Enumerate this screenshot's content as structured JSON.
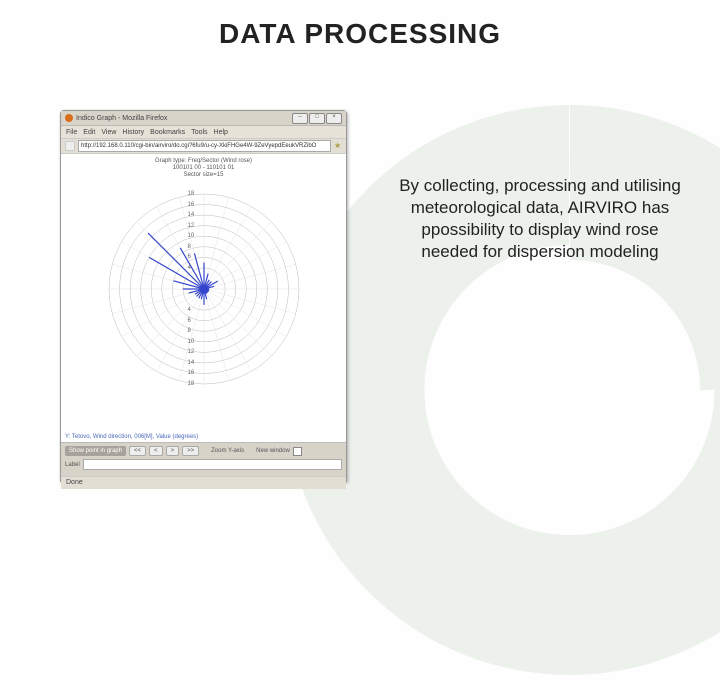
{
  "slide": {
    "title": "DATA PROCESSING",
    "body": "By collecting, processing and utilising meteorological data, AIRVIRO has ppossibility to display wind rose needed for dispersion modeling"
  },
  "window": {
    "title": "Indico Graph - Mozilla Firefox",
    "menus": [
      "File",
      "Edit",
      "View",
      "History",
      "Bookmarks",
      "Tools",
      "Help"
    ],
    "url": "http://192.168.0.110/cgi-bin/airviro/do.cgi?6fu9/u-cy-XkiFHGe4W-9ZeVyepdEeukVRZibO",
    "status": "Done"
  },
  "graph": {
    "type_line": "Graph type: Freq/Sector (Wind rose)",
    "date_range": "100101 00 - 110101 01",
    "sector": "Sector size=15",
    "ticks": [
      "18",
      "16",
      "14",
      "12",
      "10",
      "8",
      "6",
      "4"
    ],
    "y_caption": "Y: Tetovo, Wind direction, 006[M], Value (degrees)"
  },
  "controls": {
    "show_point": "Show point in graph",
    "nav": [
      "<<",
      "<",
      ">",
      ">>"
    ],
    "zoom_label": "Zoom Y-axis",
    "new_window": "New window",
    "label_label": "Label"
  },
  "chart_data": {
    "type": "windrose",
    "title": "Freq/Sector (Wind rose)",
    "sector_size_deg": 15,
    "radial_ticks": [
      4,
      6,
      8,
      10,
      12,
      14,
      16,
      18
    ],
    "period": "100101 00 - 110101 01",
    "station": "Tetovo",
    "variable": "Wind direction, 006[M]",
    "units": "degrees",
    "sectors": [
      {
        "dir_deg": 0,
        "freq": 5
      },
      {
        "dir_deg": 15,
        "freq": 3
      },
      {
        "dir_deg": 30,
        "freq": 2
      },
      {
        "dir_deg": 45,
        "freq": 2
      },
      {
        "dir_deg": 60,
        "freq": 3
      },
      {
        "dir_deg": 75,
        "freq": 2
      },
      {
        "dir_deg": 90,
        "freq": 1
      },
      {
        "dir_deg": 105,
        "freq": 1
      },
      {
        "dir_deg": 120,
        "freq": 1
      },
      {
        "dir_deg": 135,
        "freq": 1
      },
      {
        "dir_deg": 150,
        "freq": 1
      },
      {
        "dir_deg": 165,
        "freq": 2
      },
      {
        "dir_deg": 180,
        "freq": 3
      },
      {
        "dir_deg": 195,
        "freq": 2
      },
      {
        "dir_deg": 210,
        "freq": 2
      },
      {
        "dir_deg": 225,
        "freq": 2
      },
      {
        "dir_deg": 240,
        "freq": 2
      },
      {
        "dir_deg": 255,
        "freq": 3
      },
      {
        "dir_deg": 270,
        "freq": 4
      },
      {
        "dir_deg": 285,
        "freq": 6
      },
      {
        "dir_deg": 300,
        "freq": 12
      },
      {
        "dir_deg": 315,
        "freq": 15
      },
      {
        "dir_deg": 330,
        "freq": 9
      },
      {
        "dir_deg": 345,
        "freq": 7
      }
    ]
  }
}
